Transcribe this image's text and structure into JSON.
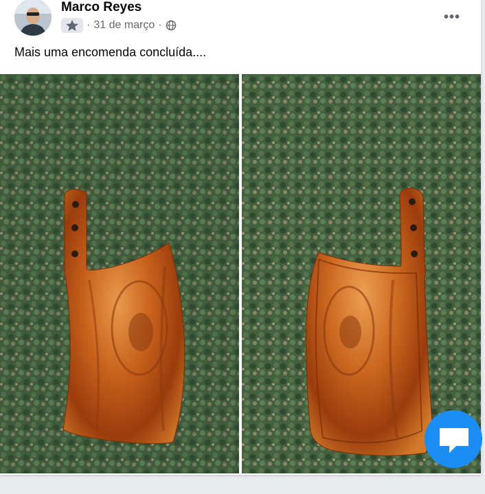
{
  "post": {
    "author_name": "Marco Reyes",
    "date": "31 de março",
    "separator": "·",
    "text": "Mais uma encomenda concluída....",
    "more_label": "•••"
  },
  "photos": [
    {
      "icon": "cutting-board-photo-left"
    },
    {
      "icon": "cutting-board-photo-right"
    }
  ],
  "colors": {
    "chat_button": "#1a8ef5",
    "wood": "#c8611c",
    "grass": "#3f5b3c"
  },
  "icons": {
    "badge": "star-icon",
    "privacy": "globe-icon",
    "chat": "chat-bubble-icon"
  }
}
